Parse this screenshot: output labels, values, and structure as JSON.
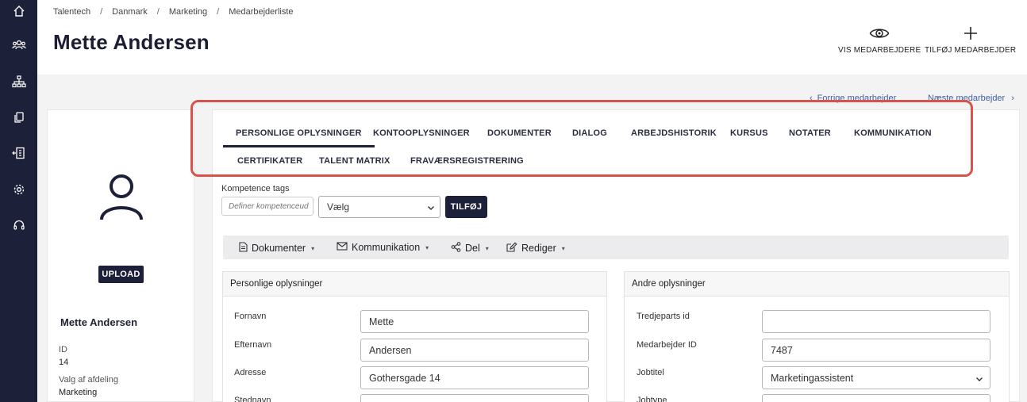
{
  "sidebar": {
    "icons": [
      "home-icon",
      "users-icon",
      "org-chart-icon",
      "documents-icon",
      "building-icon",
      "settings-icon",
      "support-icon"
    ]
  },
  "breadcrumb": [
    "Talentech",
    "Danmark",
    "Marketing",
    "Medarbejderliste"
  ],
  "page_title": "Mette Andersen",
  "header_actions": {
    "view_employees": "VIS MEDARBEJDERE",
    "add_employee": "TILFØJ MEDARBEJDER"
  },
  "nav": {
    "prev": "Forrige medarbejder",
    "next": "Næste medarbejder"
  },
  "profile": {
    "upload_label": "UPLOAD",
    "name": "Mette Andersen",
    "id_label": "ID",
    "id_value": "14",
    "dept_label": "Valg af afdeling",
    "dept_value": "Marketing"
  },
  "tabs": [
    "PERSONLIGE OPLYSNINGER",
    "KONTOOPLYSNINGER",
    "DOKUMENTER",
    "DIALOG",
    "ARBEJDSHISTORIK",
    "KURSUS",
    "NOTATER",
    "KOMMUNIKATION",
    "CERTIFIKATER",
    "TALENT MATRIX",
    "FRAVÆRSREGISTRERING"
  ],
  "active_tab": "PERSONLIGE OPLYSNINGER",
  "competence": {
    "label": "Kompetence tags",
    "input_placeholder": "Definer kompetenceud",
    "select_value": "Vælg",
    "add_button": "TILFØJ"
  },
  "toolbar": {
    "documents": "Dokumenter",
    "communication": "Kommunikation",
    "share": "Del",
    "edit": "Rediger"
  },
  "personal": {
    "title": "Personlige oplysninger",
    "fields": [
      {
        "label": "Fornavn",
        "value": "Mette"
      },
      {
        "label": "Efternavn",
        "value": "Andersen"
      },
      {
        "label": "Adresse",
        "value": "Gothersgade 14"
      },
      {
        "label": "Stednavn",
        "value": ""
      }
    ]
  },
  "other": {
    "title": "Andre oplysninger",
    "fields": [
      {
        "label": "Tredjeparts id",
        "value": ""
      },
      {
        "label": "Medarbejder ID",
        "value": "7487"
      },
      {
        "label": "Jobtitel",
        "value": "Marketingassistent"
      },
      {
        "label": "Jobtype",
        "value": ""
      }
    ]
  },
  "colors": {
    "sidebar": "#1d2039",
    "highlight": "#d9534a",
    "link": "#3f5fa8"
  }
}
